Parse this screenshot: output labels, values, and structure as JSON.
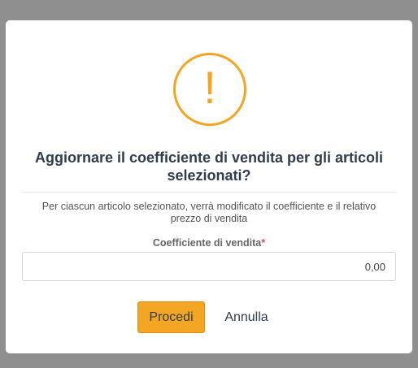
{
  "dialog": {
    "icon": "exclamation-icon",
    "icon_glyph": "!",
    "title": "Aggiornare il coefficiente di vendita per gli articoli selezionati?",
    "message": "Per ciascun articolo selezionato, verrà modificato il coefficiente e il relativo prezzo di vendita",
    "field": {
      "label": "Coefficiente di vendita",
      "required_marker": "*",
      "value": "0,00"
    },
    "buttons": {
      "confirm_label": "Procedi",
      "cancel_label": "Annulla"
    }
  },
  "colors": {
    "accent": "#f3a524",
    "title": "#2f3d4c",
    "overlay": "#8f8f8f"
  }
}
